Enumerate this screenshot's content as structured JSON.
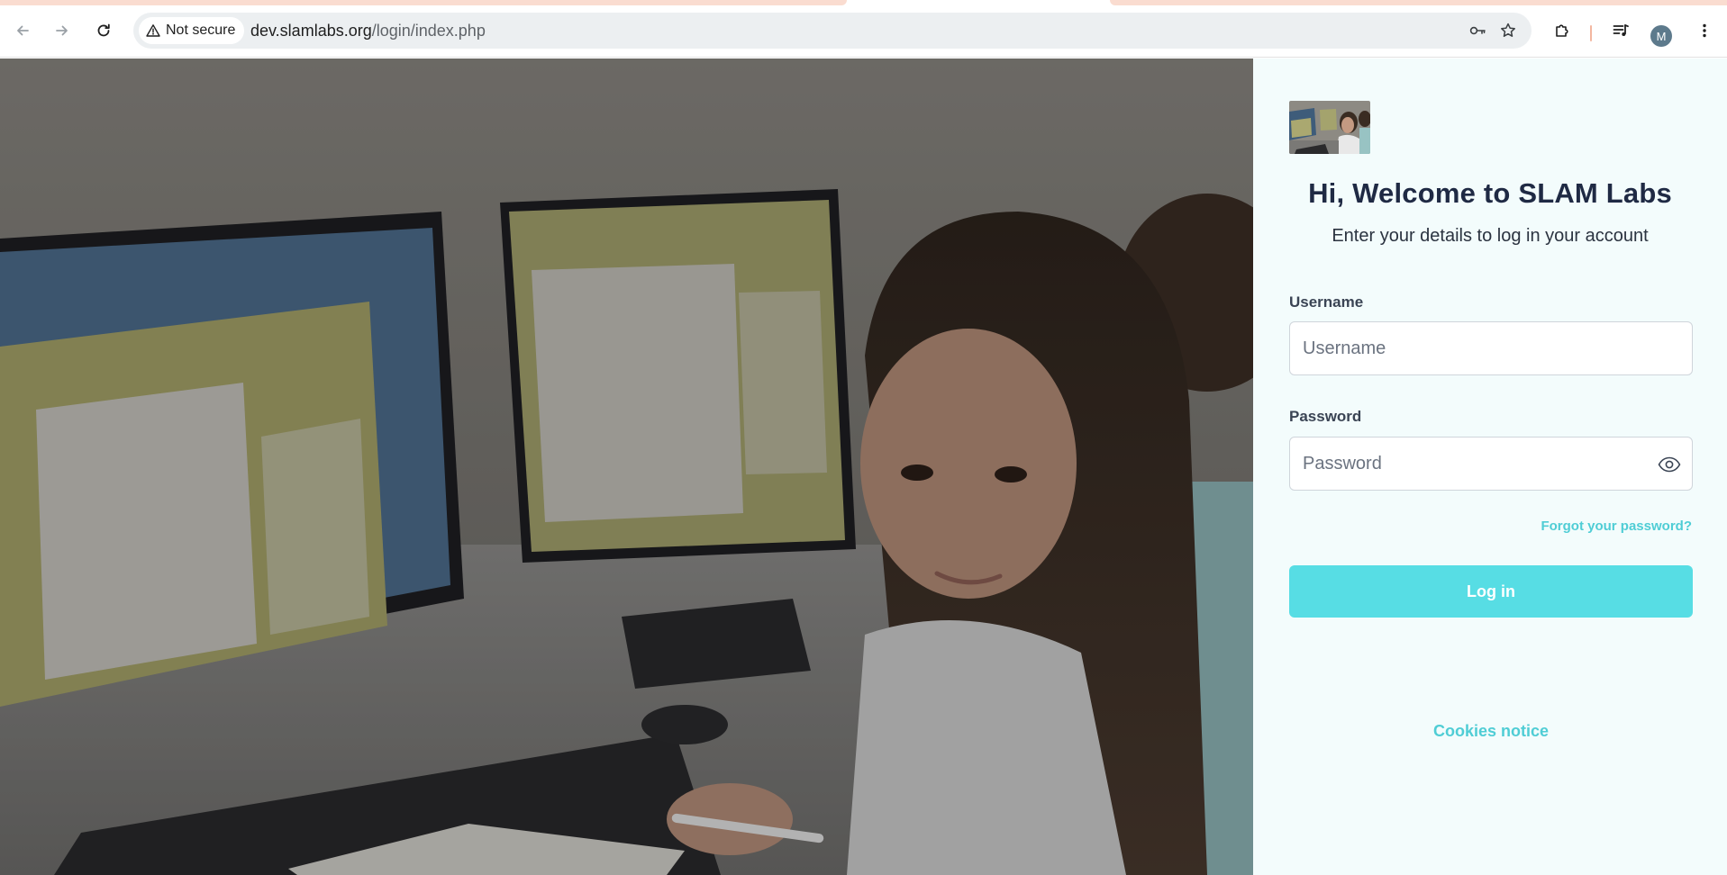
{
  "browser": {
    "security_label": "Not secure",
    "url_host": "dev.slamlabs.org",
    "url_path": "/login/index.php",
    "profile_initial": "M",
    "icons": [
      "back-arrow-icon",
      "forward-arrow-icon",
      "reload-icon",
      "warning-triangle-icon",
      "password-key-icon",
      "bookmark-star-icon",
      "extensions-puzzle-icon",
      "media-queue-icon",
      "kebab-menu-icon"
    ]
  },
  "hero": {
    "image_alt": "Girl at a computer lab with mathematics software on screens"
  },
  "login": {
    "title": "Hi, Welcome to SLAM Labs",
    "subtitle": "Enter your details to log in your account",
    "username_label": "Username",
    "username_placeholder": "Username",
    "username_value": "",
    "password_label": "Password",
    "password_placeholder": "Password",
    "password_value": "",
    "forgot_link": "Forgot your password?",
    "submit_label": "Log in",
    "cookies_link": "Cookies notice"
  },
  "colors": {
    "accent": "#57dde4",
    "link": "#4fcdd5",
    "heading": "#1f2a44",
    "panel_bg": "#f3fcfc"
  }
}
